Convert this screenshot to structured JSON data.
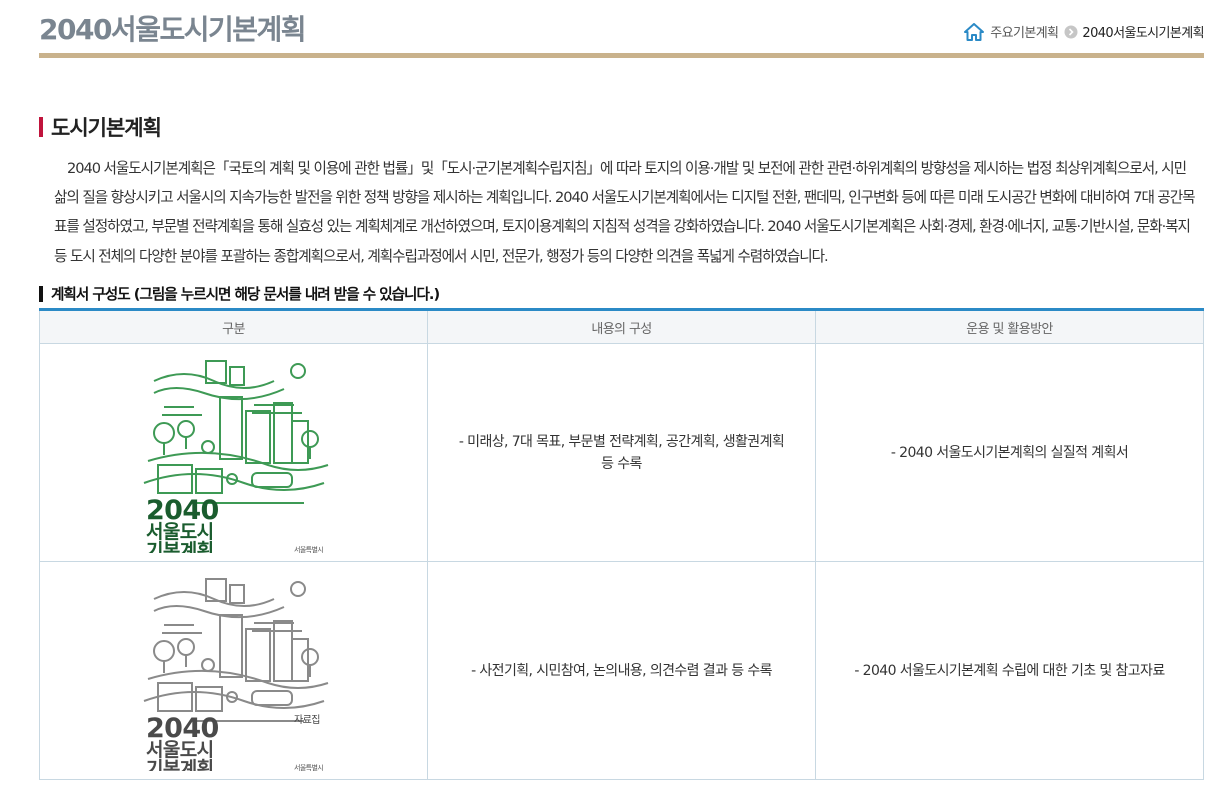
{
  "header": {
    "title": "2040서울도시기본계획",
    "breadcrumb": {
      "parent": "주요기본계획",
      "current": "2040서울도시기본계획"
    }
  },
  "section": {
    "title": "도시기본계획",
    "intro": "2040 서울도시기본계획은「국토의 계획 및 이용에 관한 법률」및「도시·군기본계획수립지침」에 따라 토지의 이용·개발 및 보전에 관한 관련·하위계획의 방향성을 제시하는 법정 최상위계획으로서, 시민 삶의 질을 향상시키고 서울시의 지속가능한 발전을 위한 정책 방향을 제시하는 계획입니다. 2040 서울도시기본계획에서는 디지털 전환, 팬데믹, 인구변화 등에 따른 미래 도시공간 변화에 대비하여 7대 공간목표를 설정하였고, 부문별 전략계획을 통해 실효성 있는 계획체계로 개선하였으며, 토지이용계획의 지침적 성격을 강화하였습니다. 2040 서울도시기본계획은 사회·경제, 환경·에너지, 교통·기반시설, 문화·복지 등 도시 전체의 다양한 분야를 포괄하는 종합계획으로서, 계획수립과정에서 시민, 전문가, 행정가 등의 다양한 의견을 폭넓게 수렴하였습니다."
  },
  "structure": {
    "heading": "계획서 구성도 (그림을 누르시면 해당 문서를 내려 받을 수 있습니다.)",
    "columns": [
      "구분",
      "내용의 구성",
      "운용 및 활용방안"
    ],
    "rows": [
      {
        "cover": {
          "line1": "2040",
          "line2": "서울도시",
          "line3": "기본계획",
          "badge": "",
          "publisher": "서울특별시",
          "color": "#1a5c2e",
          "line_color": "#3e9a55"
        },
        "contents": "- 미래상, 7대 목표, 부문별 전략계획, 공간계획, 생활권계획 등 수록",
        "usage": "- 2040 서울도시기본계획의 실질적 계획서"
      },
      {
        "cover": {
          "line1": "2040",
          "line2": "서울도시",
          "line3": "기본계획",
          "badge": "자료집",
          "publisher": "서울특별시",
          "color": "#4a4a4a",
          "line_color": "#8a8a8a"
        },
        "contents": "- 사전기획, 시민참여, 논의내용, 의견수렴 결과 등 수록",
        "usage": "- 2040 서울도시기본계획 수립에 대한 기초 및 참고자료"
      }
    ]
  }
}
